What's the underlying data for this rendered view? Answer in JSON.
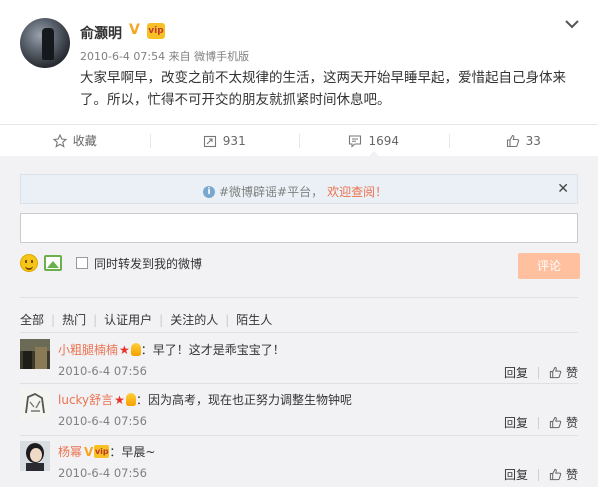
{
  "post": {
    "username": "俞灏明",
    "verified_mark": "V",
    "vip_mark": "vip",
    "timestamp": "2010-6-4 07:54",
    "source_prefix": "来自",
    "source": "微博手机版",
    "text": "大家早啊早，改变之前不太规律的生活，这两天开始早睡早起，爱惜起自己身体来了。所以，忙得不可开交的朋友就抓紧时间休息吧。"
  },
  "actions": {
    "favorite_label": "收藏",
    "repost_count": "931",
    "comment_count": "1694",
    "like_count": "33"
  },
  "notice": {
    "topic": "#微博辟谣#平台，",
    "link": "欢迎查阅！"
  },
  "composer": {
    "input_value": "",
    "repost_checkbox_label": "同时转发到我的微博",
    "submit_label": "评论"
  },
  "filters": [
    "全部",
    "热门",
    "认证用户",
    "关注的人",
    "陌生人"
  ],
  "comments": [
    {
      "user": "小粗腿楠楠",
      "text": "：早了！这才是乖宝宝了！",
      "time": "2010-6-4 07:56",
      "reply": "回复",
      "like": "赞"
    },
    {
      "user": "lucky舒言",
      "text": "：因为高考，现在也正努力调整生物钟呢",
      "time": "2010-6-4 07:56",
      "reply": "回复",
      "like": "赞"
    },
    {
      "user": "杨幂",
      "text": "：早晨~",
      "time": "2010-6-4 07:56",
      "reply": "回复",
      "like": "赞"
    }
  ],
  "colors": {
    "accent_orange": "#eb7350",
    "panel_bg": "#f2f2f5",
    "submit_disabled": "#ffc09f",
    "verified_gold": "#f5a623"
  }
}
